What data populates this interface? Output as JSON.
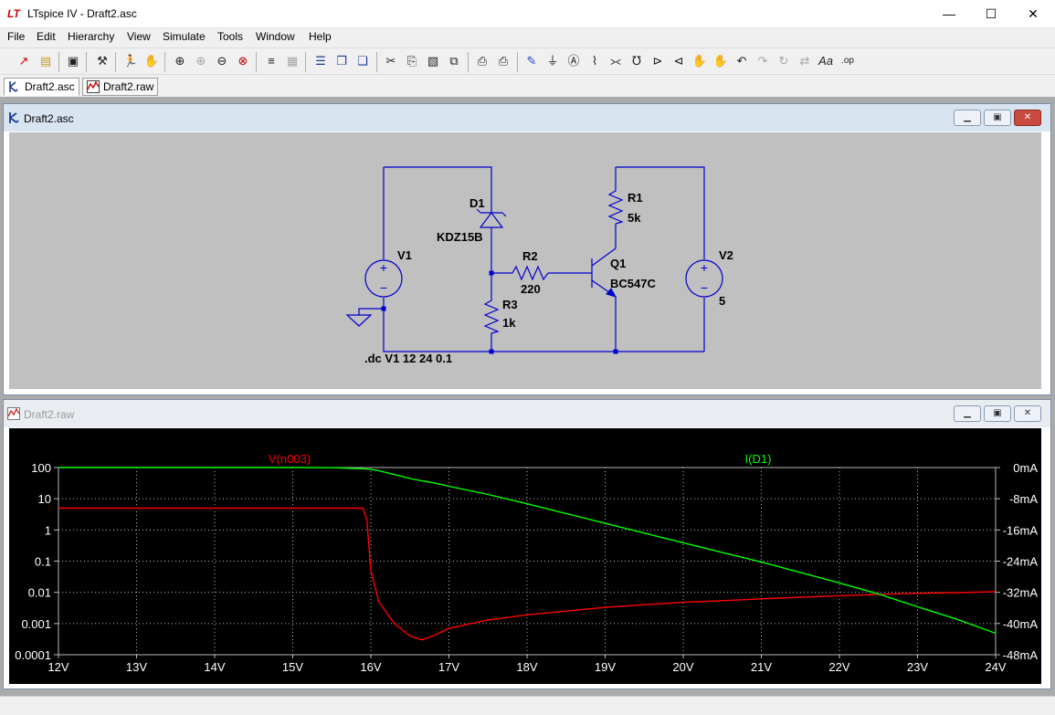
{
  "window": {
    "title": "LTspice IV - Draft2.asc",
    "logo": "LT"
  },
  "menu": [
    "File",
    "Edit",
    "Hierarchy",
    "View",
    "Simulate",
    "Tools",
    "Window",
    "Help"
  ],
  "tabs": [
    {
      "label": "Draft2.asc",
      "icon": "schematic-icon"
    },
    {
      "label": "Draft2.raw",
      "icon": "waveform-icon"
    }
  ],
  "schematic": {
    "title": "Draft2.asc",
    "components": {
      "v1": {
        "name": "V1"
      },
      "v2": {
        "name": "V2",
        "value": "5"
      },
      "d1": {
        "name": "D1",
        "value": "KDZ15B"
      },
      "r1": {
        "name": "R1",
        "value": "5k"
      },
      "r2": {
        "name": "R2",
        "value": "220"
      },
      "r3": {
        "name": "R3",
        "value": "1k"
      },
      "q1": {
        "name": "Q1",
        "value": "BC547C"
      }
    },
    "directive": ".dc V1 12 24 0.1",
    "colors": {
      "wire": "#0000cc",
      "background": "#c0c0c0",
      "text": "#000000"
    }
  },
  "waveform": {
    "title": "Draft2.raw",
    "colors": {
      "background": "#000000",
      "grid": "#b8b8b8",
      "v_trace": "#ff0000",
      "i_trace": "#00ff00"
    }
  },
  "chart_data": {
    "type": "line",
    "x": [
      12,
      13,
      14,
      15,
      15.5,
      15.9,
      15.95,
      16,
      16.1,
      16.3,
      16.5,
      16.65,
      16.8,
      17,
      17.5,
      18,
      18.5,
      19,
      19.5,
      20,
      20.5,
      21,
      21.5,
      22,
      22.5,
      23,
      23.5,
      24
    ],
    "xticks": [
      "12V",
      "13V",
      "14V",
      "15V",
      "16V",
      "17V",
      "18V",
      "19V",
      "20V",
      "21V",
      "22V",
      "23V",
      "24V"
    ],
    "xlim": [
      12,
      24
    ],
    "y_left": {
      "label": "V(n003)",
      "scale": "log",
      "ylim": [
        0.0001,
        100
      ],
      "ticks": [
        "100",
        "10",
        "1",
        "0.1",
        "0.01",
        "0.001",
        "0.0001"
      ]
    },
    "y_right": {
      "label": "I(D1)",
      "scale": "linear",
      "ylim": [
        -48,
        0
      ],
      "unit": "mA",
      "ticks": [
        "0mA",
        "-8mA",
        "-16mA",
        "-24mA",
        "-32mA",
        "-40mA",
        "-48mA"
      ]
    },
    "series": [
      {
        "name": "V(n003)",
        "axis": "left",
        "color": "#ff0000",
        "values": [
          5,
          5,
          5,
          5,
          5,
          5,
          2,
          0.05,
          0.005,
          0.001,
          0.0004,
          0.0003,
          0.0004,
          0.0007,
          0.0013,
          0.0019,
          0.0025,
          0.0033,
          0.004,
          0.0048,
          0.0054,
          0.0062,
          0.007,
          0.0078,
          0.0086,
          0.0093,
          0.0098,
          0.0105
        ]
      },
      {
        "name": "I(D1)",
        "axis": "right",
        "color": "#00ff00",
        "values": [
          0,
          0,
          0,
          0,
          -0.05,
          -0.3,
          -0.4,
          -0.5,
          -0.8,
          -1.8,
          -2.8,
          -3.4,
          -3.9,
          -4.8,
          -6.9,
          -9.3,
          -11.8,
          -14.3,
          -16.8,
          -19.3,
          -21.8,
          -24.2,
          -26.9,
          -29.6,
          -32.4,
          -35.7,
          -38.9,
          -42.5
        ]
      }
    ]
  }
}
